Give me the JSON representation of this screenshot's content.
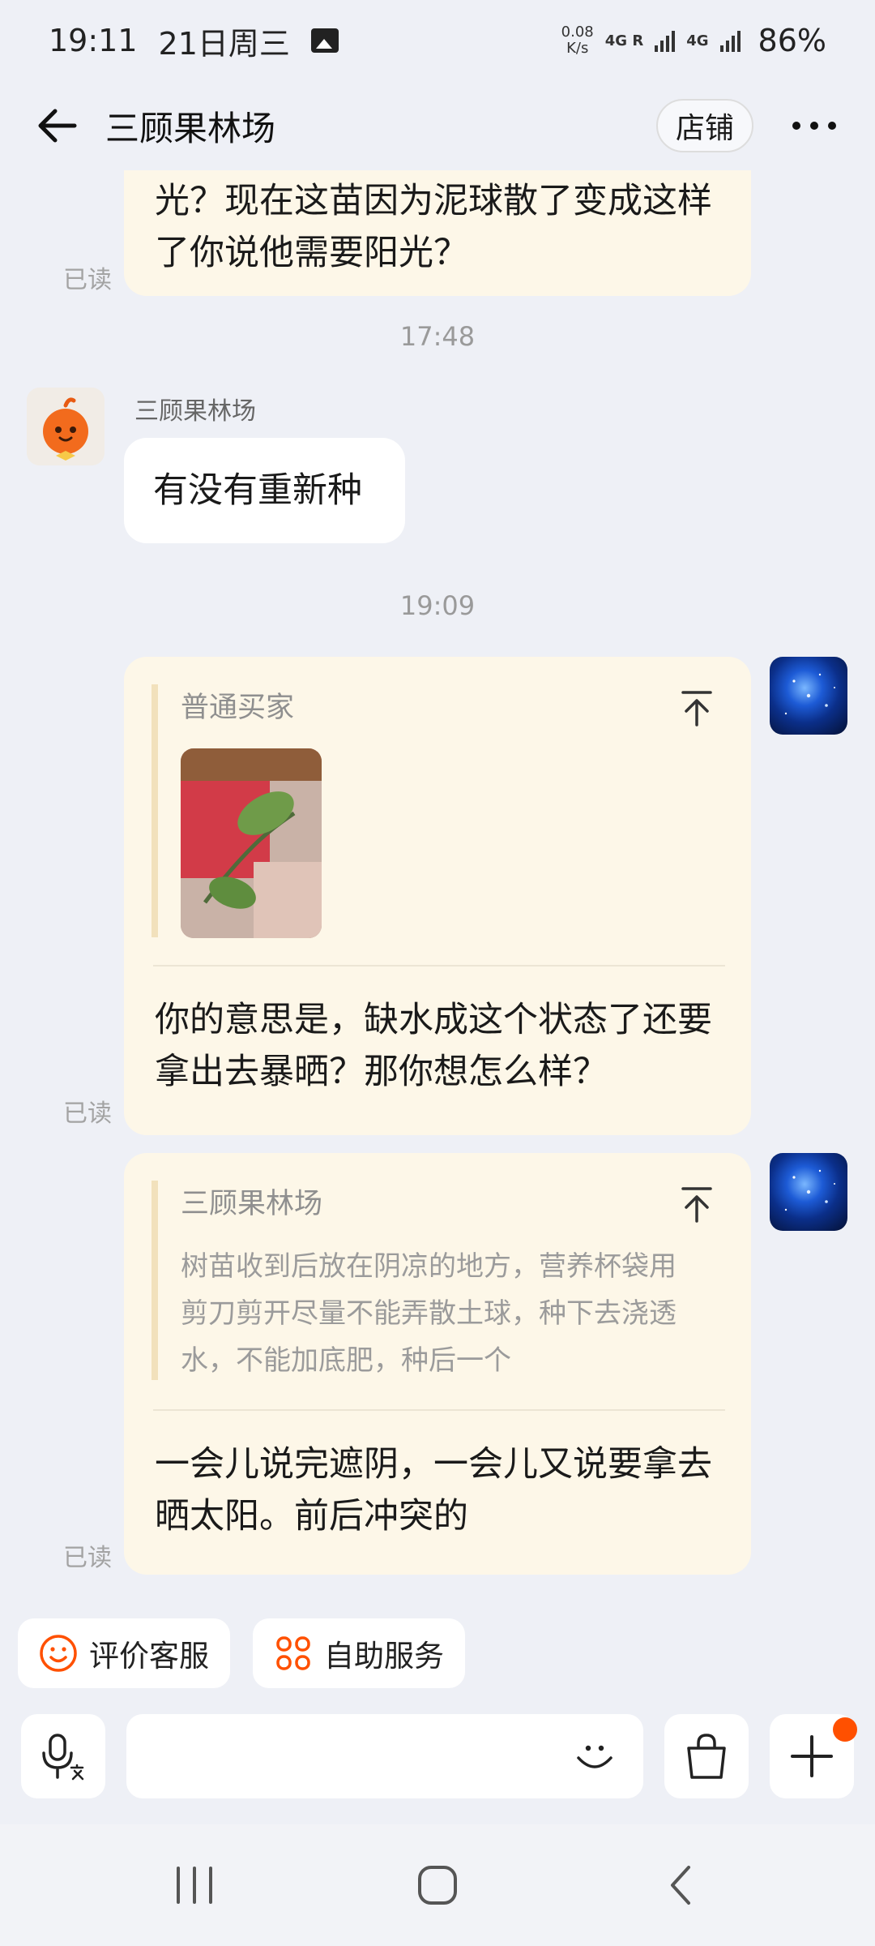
{
  "status_bar": {
    "time": "19:11",
    "date": "21日周三",
    "speed_value": "0.08",
    "speed_unit": "K/s",
    "net1": "4G",
    "net1_sub": "R",
    "net2": "4G",
    "battery": "86%"
  },
  "header": {
    "title": "三顾果林场",
    "shop_label": "店铺"
  },
  "messages": {
    "m1_text": "光？现在这苗因为泥球散了变成这样了你说他需要阳光？",
    "m1_read": "已读",
    "time1": "17:48",
    "m2_sender": "三顾果林场",
    "m2_text": "有没有重新种",
    "time2": "19:09",
    "m3_quote_name": "普通买家",
    "m3_text": "你的意思是，缺水成这个状态了还要拿出去暴晒？那你想怎么样？",
    "m3_read": "已读",
    "m4_quote_name": "三顾果林场",
    "m4_quote_text": "树苗收到后放在阴凉的地方，营养杯袋用剪刀剪开尽量不能弄散土球，种下去浇透水，不能加底肥，种后一个",
    "m4_text": "一会儿说完遮阴，一会儿又说要拿去晒太阳。前后冲突的",
    "m4_read": "已读"
  },
  "quick_actions": {
    "rate_label": "评价客服",
    "self_service_label": "自助服务"
  },
  "colors": {
    "accent": "#ff5000",
    "bubble_me": "#fdf7e8",
    "background": "#eef0f6"
  }
}
